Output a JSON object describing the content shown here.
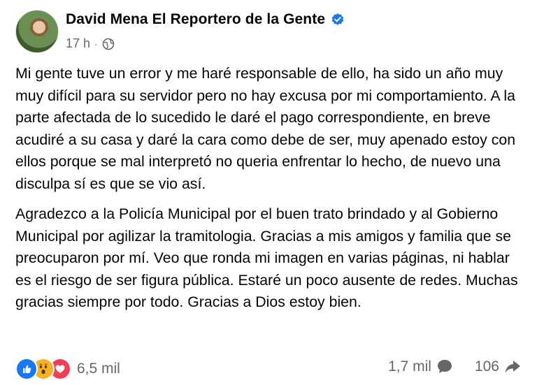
{
  "post": {
    "author": "David Mena El Reportero de la Gente",
    "time": "17 h",
    "separator": "·",
    "paragraphs": [
      "Mi gente tuve un error y me haré responsable de ello, ha sido un año muy muy difícil para su servidor pero no hay excusa por mi comportamiento. A la parte afectada de lo sucedido le daré el pago correspondiente, en breve acudiré a su casa y daré la cara como debe de ser, muy apenado estoy con ellos porque se mal interpretó no queria enfrentar lo hecho, de nuevo una disculpa sí es que se vio así.",
      "Agradezco a la Policía Municipal por el buen trato brindado y al Gobierno Municipal por agilizar la tramitologia. Gracias a mis amigos y familia que se preocuparon por mí. Veo que ronda mi imagen en varias páginas, ni hablar es el riesgo de ser figura pública. Estaré un poco ausente de redes. Muchas gracias siempre por todo. Gracias a Dios estoy bien."
    ],
    "reactions": {
      "icons": [
        "like-icon",
        "wow-icon",
        "love-icon"
      ],
      "count": "6,5 mil"
    },
    "comments_count": "1,7 mil",
    "shares_count": "106"
  },
  "colors": {
    "verified": "#1877f2",
    "secondary_text": "#65676b",
    "like": "#1877f2",
    "wow": "#f7b125",
    "love": "#f33e58"
  }
}
